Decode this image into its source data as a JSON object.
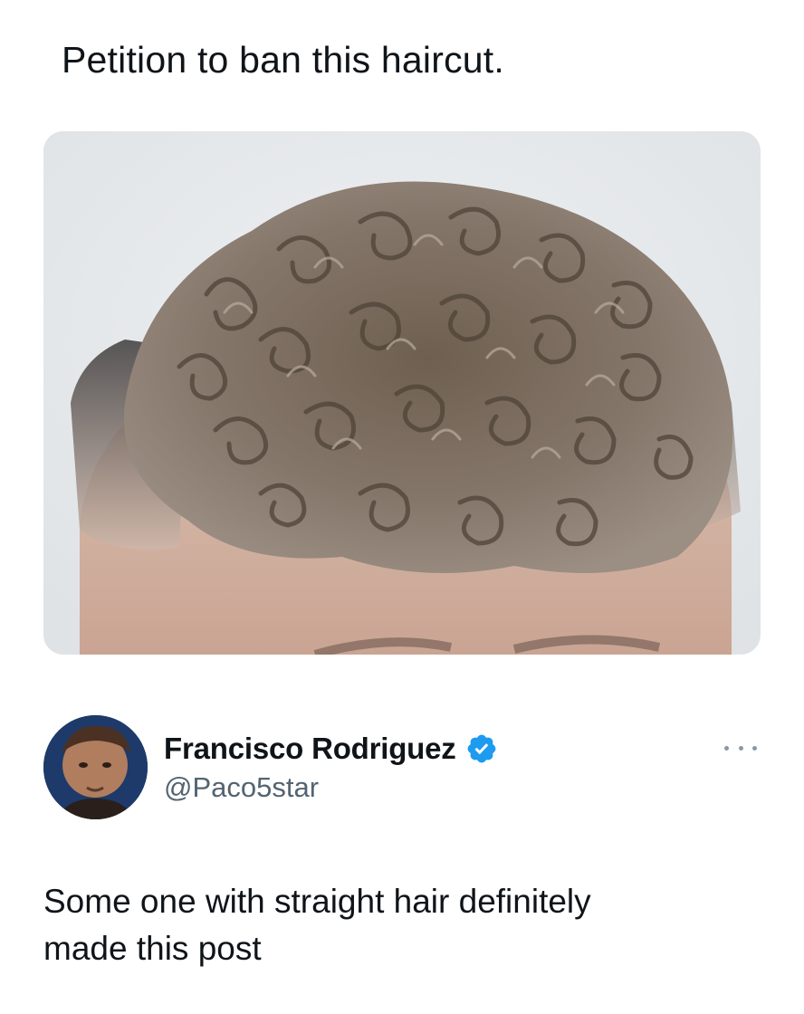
{
  "quoted_post": {
    "text": "Petition to ban this haircut.",
    "media": {
      "icon": "photo-curly-haircut"
    }
  },
  "author": {
    "display_name": "Francisco Rodriguez",
    "handle": "@Paco5star",
    "verified": true,
    "verified_color": "#1d9bf0",
    "avatar_icon": "avatar-photo"
  },
  "post": {
    "text_lines": [
      "Some one with straight hair definitely",
      "made this post"
    ]
  },
  "menu": {
    "icon": "more-options-icon"
  }
}
